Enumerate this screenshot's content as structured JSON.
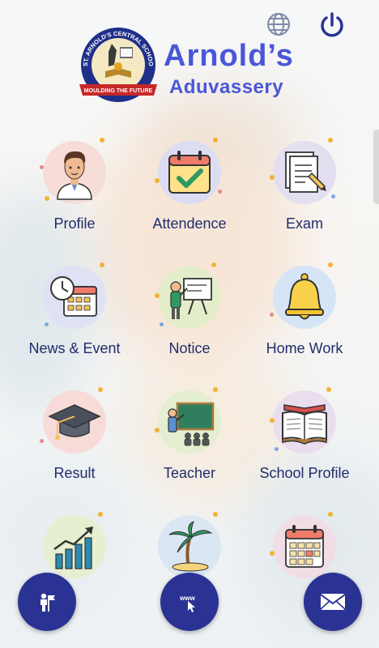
{
  "header": {
    "title_line1": "Arnold’s",
    "title_line2": "Aduvassery",
    "globe_icon": "globe-icon",
    "power_icon": "power-icon"
  },
  "logo": {
    "arc_text": "ST. ARNOLD'S CENTRAL SCHOOL, ADUVASSERY",
    "ribbon_text": "MOULDING THE FUTURE"
  },
  "menu": [
    {
      "label": "Profile",
      "icon": "profile-icon",
      "bg": "#f6ddd8"
    },
    {
      "label": "Attendence",
      "icon": "attendance-icon",
      "bg": "#dcdcf2"
    },
    {
      "label": "Exam",
      "icon": "exam-icon",
      "bg": "#e3def0"
    },
    {
      "label": "News & Event",
      "icon": "news-event-icon",
      "bg": "#dfe2f5"
    },
    {
      "label": "Notice",
      "icon": "notice-icon",
      "bg": "#e3edc9"
    },
    {
      "label": "Home Work",
      "icon": "bell-icon",
      "bg": "#d6e5f5"
    },
    {
      "label": "Result",
      "icon": "graduation-cap-icon",
      "bg": "#f6dbd8"
    },
    {
      "label": "Teacher",
      "icon": "teacher-icon",
      "bg": "#e4eed0"
    },
    {
      "label": "School Profile",
      "icon": "book-icon",
      "bg": "#e9ddee"
    },
    {
      "label": "",
      "icon": "growth-chart-icon",
      "bg": "#e6efcf"
    },
    {
      "label": "",
      "icon": "holiday-icon",
      "bg": "#dbe6f3"
    },
    {
      "label": "",
      "icon": "calendar-icon",
      "bg": "#f0dde6"
    }
  ],
  "bottom_bar": {
    "left_icon": "admission-icon",
    "mid_text": "www",
    "mid_icon": "website-icon",
    "right_icon": "mail-icon"
  },
  "colors": {
    "title": "#4a56d8",
    "label": "#1f2d6b",
    "fab": "#2a3394",
    "power": "#2a3394"
  }
}
